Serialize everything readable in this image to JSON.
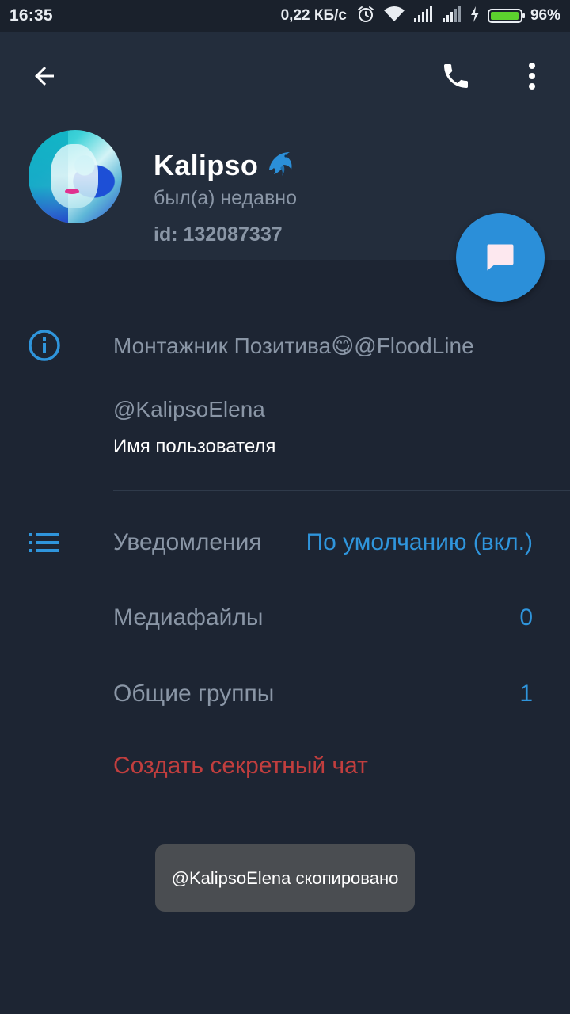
{
  "status_bar": {
    "time": "16:35",
    "network_speed": "0,22 КБ/с",
    "battery_percent_text": "96%",
    "battery_level": 0.96,
    "icons": [
      "alarm-icon",
      "wifi-icon",
      "signal-icon",
      "signal-icon",
      "charging-icon",
      "battery-icon"
    ]
  },
  "header": {
    "back_icon": "arrow-left-icon",
    "call_icon": "phone-icon",
    "menu_icon": "more-vertical-icon",
    "profile": {
      "name": "Kalipso",
      "name_emoji": "🐬",
      "status": "был(а) недавно",
      "id": "id: 132087337"
    },
    "fab_icon": "message-icon"
  },
  "info": {
    "icon": "info-icon",
    "bio": "Монтажник Позитива😋@FloodLine",
    "username_value": "@KalipsoElena",
    "username_label": "Имя пользователя"
  },
  "settings": {
    "icon": "list-icon",
    "notifications_label": "Уведомления",
    "notifications_value": "По умолчанию (вкл.)",
    "media_label": "Медиафайлы",
    "media_value": "0",
    "groups_label": "Общие группы",
    "groups_value": "1",
    "secret_chat": "Создать секретный чат"
  },
  "toast": "@KalipsoElena скопировано",
  "colors": {
    "background": "#1d2533",
    "header": "#232d3c",
    "accent": "#2f95dc",
    "fab": "#2b8fd9",
    "danger": "#c13e3e",
    "muted_text": "#8a96a6",
    "battery_fill": "#5cd12e",
    "toast": "#4a4d51"
  }
}
